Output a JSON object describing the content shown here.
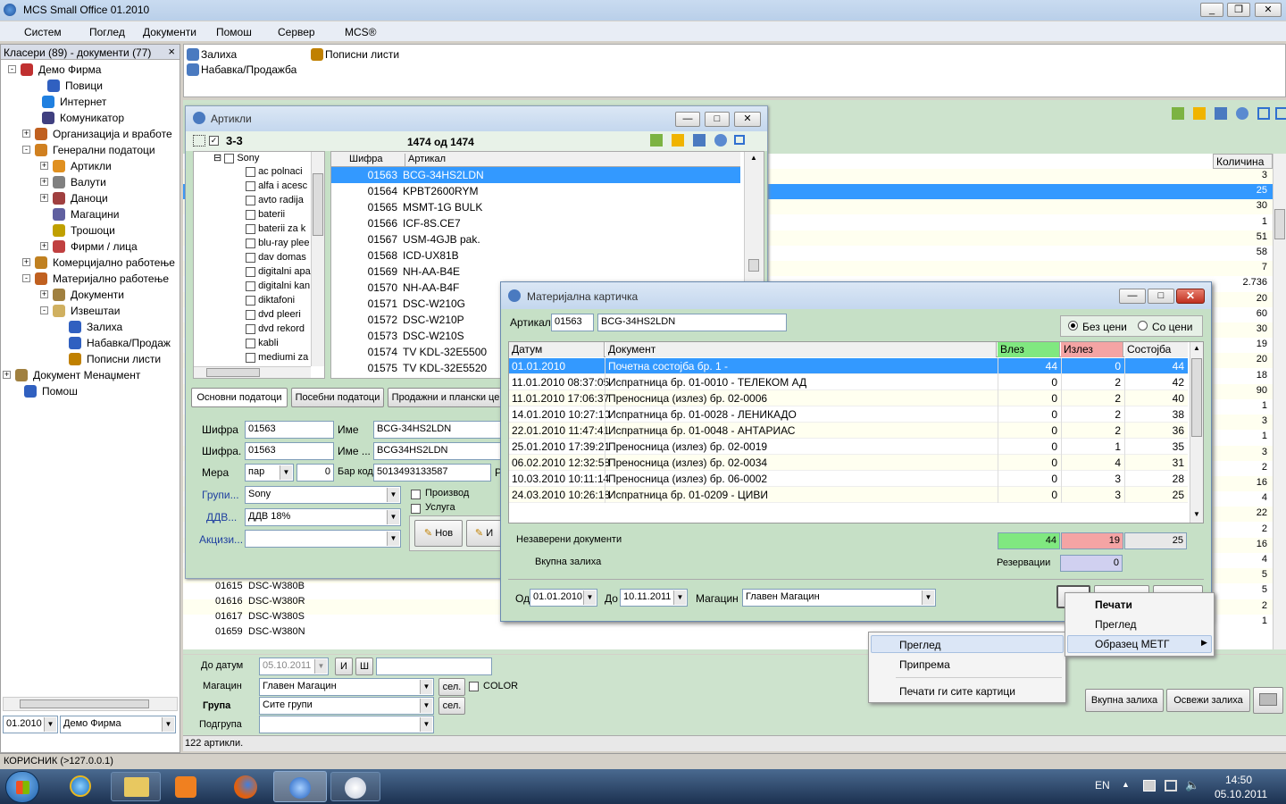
{
  "app": {
    "title": "MCS Small Office 01.2010",
    "menu": [
      "Систем",
      "Поглед",
      "Документи",
      "Помош",
      "Сервер",
      "MCS®"
    ]
  },
  "left_panel": {
    "title": "Класери (89) - документи (77)",
    "close": "×",
    "tree": [
      {
        "label": "Демо Фирма",
        "indent": 0,
        "exp": "-",
        "color": "#c03030"
      },
      {
        "label": "Повици",
        "indent": 2,
        "exp": "",
        "color": "#3060c0"
      },
      {
        "label": "Интернет",
        "indent": 2,
        "exp": "",
        "color": "#2080e0"
      },
      {
        "label": "Комуникатор",
        "indent": 2,
        "exp": "",
        "color": "#404080"
      },
      {
        "label": "Организациja и вработе",
        "indent": 1,
        "exp": "+",
        "color": "#c06020"
      },
      {
        "label": "Генерални податоци",
        "indent": 1,
        "exp": "-",
        "color": "#d08020"
      },
      {
        "label": "Артикли",
        "indent": 2,
        "exp": "+",
        "color": "#e09020"
      },
      {
        "label": "Валути",
        "indent": 2,
        "exp": "+",
        "color": "#808080"
      },
      {
        "label": "Даноци",
        "indent": 2,
        "exp": "+",
        "color": "#a04040"
      },
      {
        "label": "Магацини",
        "indent": 2,
        "exp": "",
        "color": "#6060a0"
      },
      {
        "label": "Трошоци",
        "indent": 2,
        "exp": "",
        "color": "#c0a000"
      },
      {
        "label": "Фирми / лица",
        "indent": 2,
        "exp": "+",
        "color": "#c04040"
      },
      {
        "label": "Комерциjално работење",
        "indent": 1,
        "exp": "+",
        "color": "#c08020"
      },
      {
        "label": "Материјално работење",
        "indent": 1,
        "exp": "-",
        "color": "#c06020"
      },
      {
        "label": "Документи",
        "indent": 2,
        "exp": "+",
        "color": "#a08040"
      },
      {
        "label": "Извештаи",
        "indent": 2,
        "exp": "-",
        "color": "#d0b060"
      },
      {
        "label": "Залиха",
        "indent": 3,
        "exp": "",
        "color": "#3060c0"
      },
      {
        "label": "Набавка/Продаж",
        "indent": 3,
        "exp": "",
        "color": "#3060c0"
      },
      {
        "label": "Пописни листи",
        "indent": 3,
        "exp": "",
        "color": "#c08000"
      },
      {
        "label": "Документ Менаџмент",
        "indent": 0,
        "exp": "+",
        "color": "#a08040"
      },
      {
        "label": "Помош",
        "indent": 0,
        "exp": "",
        "color": "#3060c0"
      }
    ],
    "period": "01.2010",
    "company": "Демо Фирма",
    "user": "КОРИСНИК (>127.0.0.1)"
  },
  "top_links": {
    "zaliha": "Залиха",
    "popisni": "Пописни листи",
    "nabavka": "Набавка/Продажба"
  },
  "bg_list": {
    "col_qty": "Количина",
    "qty": [
      "3",
      "25",
      "30",
      "1",
      "51",
      "58",
      "7",
      "2.736",
      "20",
      "60",
      "30",
      "19",
      "20",
      "18",
      "90",
      "1",
      "3",
      "1",
      "3",
      "2",
      "16",
      "4",
      "22",
      "2",
      "16",
      "4",
      "5",
      "5",
      "2",
      "1"
    ],
    "rows": [
      {
        "code": "01615",
        "name": "DSC-W380B"
      },
      {
        "code": "01616",
        "name": "DSC-W380R"
      },
      {
        "code": "01617",
        "name": "DSC-W380S"
      },
      {
        "code": "01659",
        "name": "DSC-W380N"
      }
    ],
    "do_datum_label": "До датум",
    "do_datum": "05.10.2011",
    "i": "И",
    "sh": "Ш",
    "magacin_label": "Магацин",
    "magacin": "Главен Магацин",
    "grupa_label": "Група",
    "grupa": "Сите групи",
    "podgrupa_label": "Подгрупа",
    "sel": "сел.",
    "color_label": "COLOR",
    "count": "122 артикли.",
    "vkupna": "Вкупна залиха",
    "osvezi": "Освежи залиха"
  },
  "articles": {
    "title": "Артикли",
    "group": "3-3",
    "count": "1474 од 1474",
    "tree_root": "Sony",
    "tree": [
      "ac polnaci",
      "alfa i acesc",
      "avto radija",
      "baterii",
      "baterii za k",
      "blu-ray plee",
      "dav domas",
      "digitalni apa",
      "digitalni kan",
      "diktafoni",
      "dvd pleeri",
      "dvd rekord",
      "kabli",
      "mediumi za"
    ],
    "col_code": "Шифра",
    "col_name": "Артикал",
    "rows": [
      {
        "code": "01563",
        "name": "BCG-34HS2LDN"
      },
      {
        "code": "01564",
        "name": "KPBT2600RYM"
      },
      {
        "code": "01565",
        "name": "MSMT-1G BULK"
      },
      {
        "code": "01566",
        "name": "ICF-8S.CE7"
      },
      {
        "code": "01567",
        "name": "USM-4GJB pak."
      },
      {
        "code": "01568",
        "name": "ICD-UX81B"
      },
      {
        "code": "01569",
        "name": "NH-AA-B4E"
      },
      {
        "code": "01570",
        "name": "NH-AA-B4F"
      },
      {
        "code": "01571",
        "name": "DSC-W210G"
      },
      {
        "code": "01572",
        "name": "DSC-W210P"
      },
      {
        "code": "01573",
        "name": "DSC-W210S"
      },
      {
        "code": "01574",
        "name": "TV KDL-32E5500"
      },
      {
        "code": "01575",
        "name": "TV KDL-32E5520"
      }
    ],
    "tabs": [
      "Основни податоци",
      "Посебни податоци",
      "Продажни и плански це"
    ],
    "sifra_label": "Шифра",
    "sifra": "01563",
    "sifra2_label": "Шифра.",
    "sifra2": "01563",
    "ime_label": "Име",
    "ime": "BCG-34HS2LDN",
    "ime2_label": "Име ...",
    "ime2": "BCG34HS2LDN",
    "mera_label": "Мера",
    "mera": "пар",
    "mera_num": "0",
    "barkod_label": "Бар код",
    "barkod": "5013493133587",
    "r": "Р",
    "grupi_label": "Групи...",
    "grupi": "Sony",
    "ddv_label": "ДДВ...",
    "ddv": "ДДВ 18%",
    "akcizi_label": "Акцизи...",
    "proizvod": "Производ",
    "usluga": "Услуга",
    "nov": "Нов",
    "i_btn": "И"
  },
  "card": {
    "title": "Материјална картичка",
    "artikal_label": "Артикал",
    "code": "01563",
    "name": "BCG-34HS2LDN",
    "radio_bez": "Без цени",
    "radio_so": "Со цени",
    "cols": [
      "Датум",
      "Документ",
      "Влез",
      "Излез",
      "Состојба"
    ],
    "rows": [
      {
        "date": "01.01.2010",
        "doc": "Почетна состојба бр. 1 -",
        "in": "44",
        "out": "0",
        "bal": "44"
      },
      {
        "date": "11.01.2010 08:37:05",
        "doc": "Испратница бр. 01-0010 -  ТЕЛЕКОМ АД",
        "in": "0",
        "out": "2",
        "bal": "42"
      },
      {
        "date": "11.01.2010 17:06:37",
        "doc": "Преносница (излез) бр. 02-0006",
        "in": "0",
        "out": "2",
        "bal": "40"
      },
      {
        "date": "14.01.2010 10:27:10",
        "doc": "Испратница бр. 01-0028 - ЛЕНИКАДО",
        "in": "0",
        "out": "2",
        "bal": "38"
      },
      {
        "date": "22.01.2010 11:47:41",
        "doc": "Испратница бр. 01-0048 - АНТАРИАС",
        "in": "0",
        "out": "2",
        "bal": "36"
      },
      {
        "date": "25.01.2010 17:39:21",
        "doc": "Преносница (излез) бр. 02-0019",
        "in": "0",
        "out": "1",
        "bal": "35"
      },
      {
        "date": "06.02.2010 12:32:58",
        "doc": "Преносница (излез) бр. 02-0034",
        "in": "0",
        "out": "4",
        "bal": "31"
      },
      {
        "date": "10.03.2010 10:11:14",
        "doc": "Преносница (излез) бр. 06-0002",
        "in": "0",
        "out": "3",
        "bal": "28"
      },
      {
        "date": "24.03.2010 10:26:18",
        "doc": "Испратница бр. 01-0209 - ЦИВИ",
        "in": "0",
        "out": "3",
        "bal": "25"
      }
    ],
    "nezavereni": "Незаверени документи",
    "vkupna": "Вкупна залиха",
    "rezervacii": "Резервации",
    "sum_in": "44",
    "sum_out": "19",
    "sum_bal": "25",
    "rez": "0",
    "od_label": "Од",
    "od": "01.01.2010",
    "do_label": "До",
    "do": "10.11.2011",
    "magacin_label": "Магацин",
    "magacin": "Главен Магацин"
  },
  "menu1": {
    "items": [
      "Печати",
      "Преглед",
      "Образец МЕТГ"
    ]
  },
  "menu2": {
    "items": [
      "Преглед",
      "Припрема",
      "Печати ги сите картици"
    ]
  },
  "taskbar": {
    "lang": "EN",
    "time": "14:50",
    "date": "05.10.2011"
  }
}
